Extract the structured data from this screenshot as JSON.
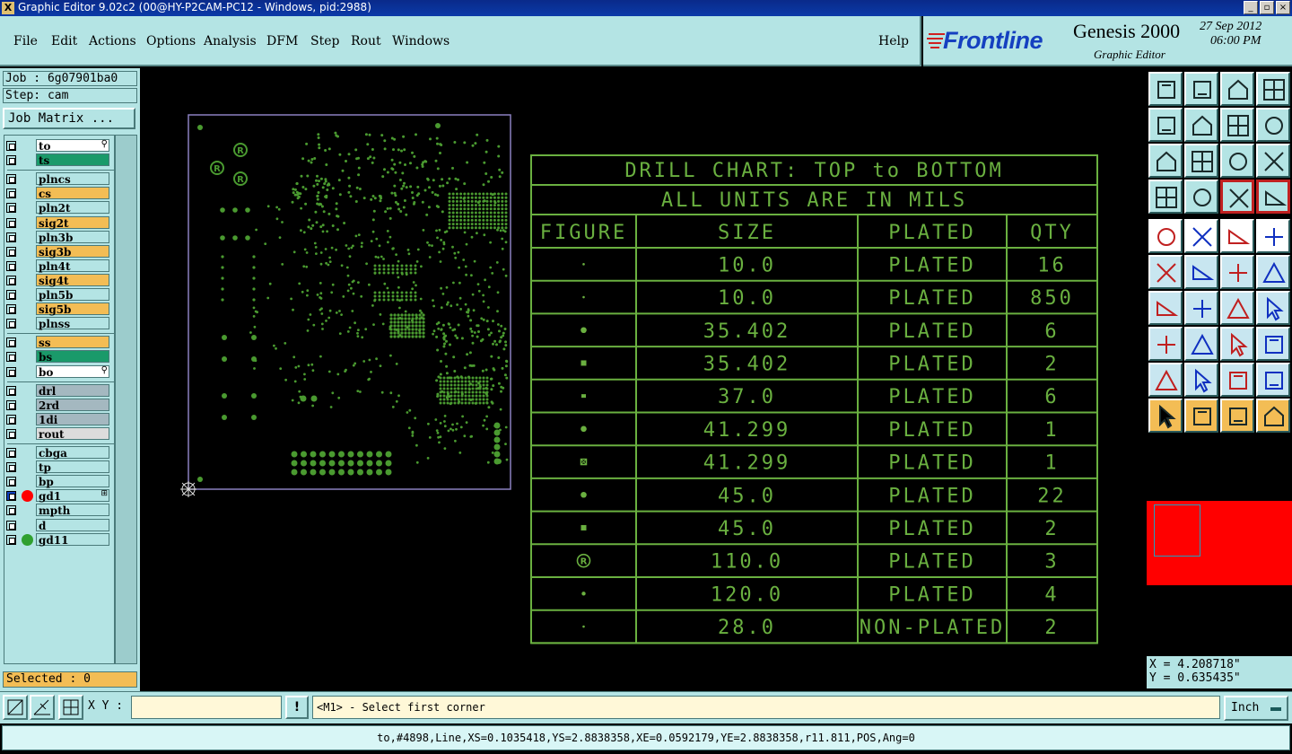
{
  "window": {
    "title": "Graphic Editor 9.02c2 (00@HY-P2CAM-PC12 - Windows, pid:2988)",
    "close_glyph": "X"
  },
  "menu": {
    "items": [
      "File",
      "Edit",
      "Actions",
      "Options",
      "Analysis",
      "DFM",
      "Step",
      "Rout",
      "Windows"
    ],
    "help": "Help"
  },
  "branding": {
    "brand": "Frontline",
    "product": "Genesis 2000",
    "subtitle": "Graphic Editor",
    "date": "27 Sep 2012",
    "time": "06:00 PM",
    "brand_color": "#1540c0"
  },
  "job": {
    "job_label": "Job : 6g07901ba0",
    "step_label": "Step: cam",
    "matrix_button": "Job Matrix ..."
  },
  "layers": [
    {
      "name": "to",
      "color": "#ffffff",
      "flag": "edit"
    },
    {
      "name": "ts",
      "color": "#1a9a6a"
    },
    {
      "name": "plncs",
      "color": "#b4e4e4"
    },
    {
      "name": "cs",
      "color": "#f3bd55"
    },
    {
      "name": "pln2t",
      "color": "#b4e4e4"
    },
    {
      "name": "sig2t",
      "color": "#f3bd55"
    },
    {
      "name": "pln3b",
      "color": "#b4e4e4"
    },
    {
      "name": "sig3b",
      "color": "#f3bd55"
    },
    {
      "name": "pln4t",
      "color": "#b4e4e4"
    },
    {
      "name": "sig4t",
      "color": "#f3bd55"
    },
    {
      "name": "pln5b",
      "color": "#b4e4e4"
    },
    {
      "name": "sig5b",
      "color": "#f3bd55"
    },
    {
      "name": "plnss",
      "color": "#b4e4e4"
    },
    {
      "name": "ss",
      "color": "#f3bd55"
    },
    {
      "name": "bs",
      "color": "#1a9a6a"
    },
    {
      "name": "bo",
      "color": "#ffffff",
      "flag": "edit"
    },
    {
      "name": "drl",
      "color": "#a4b8c0"
    },
    {
      "name": "2rd",
      "color": "#a4b8c0"
    },
    {
      "name": "1di",
      "color": "#a4b8c0"
    },
    {
      "name": "rout",
      "color": "#dcdcdc"
    },
    {
      "name": "cbga",
      "color": "#b4e4e4"
    },
    {
      "name": "tp",
      "color": "#b4e4e4"
    },
    {
      "name": "bp",
      "color": "#b4e4e4"
    },
    {
      "name": "gd1",
      "color": "#b4e4e4",
      "dot": "#ff0000",
      "active": true
    },
    {
      "name": "mpth",
      "color": "#b4e4e4"
    },
    {
      "name": "d",
      "color": "#b4e4e4"
    },
    {
      "name": "gd11",
      "color": "#b4e4e4",
      "dot": "#30a030"
    }
  ],
  "selected": "Selected : 0",
  "drill_chart": {
    "title": "DRILL CHART: TOP to BOTTOM",
    "subtitle": "ALL UNITS ARE IN MILS",
    "headers": [
      "FIGURE",
      "SIZE",
      "PLATED",
      "QTY"
    ],
    "rows": [
      {
        "figure": "dot-small",
        "size": "10.0",
        "plated": "PLATED",
        "qty": "16"
      },
      {
        "figure": "dot-small",
        "size": "10.0",
        "plated": "PLATED",
        "qty": "850"
      },
      {
        "figure": "circle",
        "size": "35.402",
        "plated": "PLATED",
        "qty": "6"
      },
      {
        "figure": "square",
        "size": "35.402",
        "plated": "PLATED",
        "qty": "2"
      },
      {
        "figure": "square-small",
        "size": "37.0",
        "plated": "PLATED",
        "qty": "6"
      },
      {
        "figure": "circle",
        "size": "41.299",
        "plated": "PLATED",
        "qty": "1"
      },
      {
        "figure": "square-x",
        "size": "41.299",
        "plated": "PLATED",
        "qty": "1"
      },
      {
        "figure": "circle",
        "size": "45.0",
        "plated": "PLATED",
        "qty": "22"
      },
      {
        "figure": "square",
        "size": "45.0",
        "plated": "PLATED",
        "qty": "2"
      },
      {
        "figure": "registered",
        "size": "110.0",
        "plated": "PLATED",
        "qty": "3"
      },
      {
        "figure": "dot-mid",
        "size": "120.0",
        "plated": "PLATED",
        "qty": "4"
      },
      {
        "figure": "dot-small",
        "size": "28.0",
        "plated": "NON-PLATED",
        "qty": "2"
      }
    ],
    "figure_glyphs": {
      "registered": "®"
    }
  },
  "coords": {
    "x": "X = 4.208718\"",
    "y": "Y = 0.635435\""
  },
  "command": {
    "xy_label": "X Y :",
    "xy_value": "",
    "excl": "!",
    "prompt": "<M1> - Select first corner",
    "units": "Inch"
  },
  "status": "to,#4898,Line,XS=0.1035418,YS=2.8838358,XE=0.0592179,YE=2.8838358,r11.811,POS,Ang=0",
  "colors": {
    "accent": "#b4e4e4",
    "drawing": "#4a9a30",
    "chart_line": "#6ab040",
    "highlight": "#f3bd55"
  }
}
